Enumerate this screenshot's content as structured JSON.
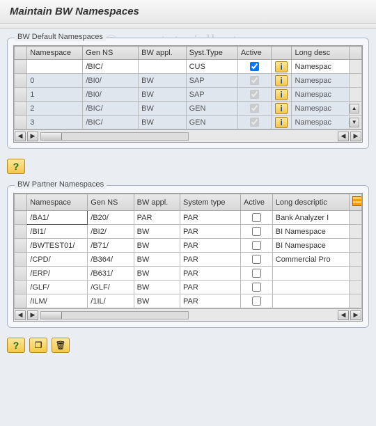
{
  "title": "Maintain BW Namespaces",
  "watermark": "© www.tutorialkart.com",
  "section1": {
    "label": "BW Default Namespaces",
    "columns": [
      "Namespace",
      "Gen NS",
      "BW appl.",
      "Syst.Type",
      "Active",
      "",
      "Long desc"
    ],
    "rows": [
      {
        "ns": "",
        "gen": "/BIC/",
        "bw": "",
        "st": "CUS",
        "active": true,
        "ro": false,
        "desc": "Namespac"
      },
      {
        "ns": "0",
        "gen": "/BI0/",
        "bw": "BW",
        "st": "SAP",
        "active": true,
        "ro": true,
        "desc": "Namespac"
      },
      {
        "ns": "1",
        "gen": "/BI0/",
        "bw": "BW",
        "st": "SAP",
        "active": true,
        "ro": true,
        "desc": "Namespac"
      },
      {
        "ns": "2",
        "gen": "/BIC/",
        "bw": "BW",
        "st": "GEN",
        "active": true,
        "ro": true,
        "desc": "Namespac"
      },
      {
        "ns": "3",
        "gen": "/BIC/",
        "bw": "BW",
        "st": "GEN",
        "active": true,
        "ro": true,
        "desc": "Namespac"
      }
    ]
  },
  "section2": {
    "label": "BW Partner Namespaces",
    "columns": [
      "Namespace",
      "Gen NS",
      "BW appl.",
      "System type",
      "Active",
      "Long descriptic"
    ],
    "rows": [
      {
        "ns": "/BA1/",
        "gen": "/B20/",
        "bw": "PAR",
        "st": "PAR",
        "active": false,
        "desc": "Bank Analyzer I",
        "sel": true
      },
      {
        "ns": "/BI1/",
        "gen": "/BI2/",
        "bw": "BW",
        "st": "PAR",
        "active": false,
        "desc": "BI Namespace "
      },
      {
        "ns": "/BWTEST01/",
        "gen": "/B71/",
        "bw": "BW",
        "st": "PAR",
        "active": false,
        "desc": "BI Namespace "
      },
      {
        "ns": "/CPD/",
        "gen": "/B364/",
        "bw": "BW",
        "st": "PAR",
        "active": false,
        "desc": "Commercial Pro"
      },
      {
        "ns": "/ERP/",
        "gen": "/B631/",
        "bw": "BW",
        "st": "PAR",
        "active": false,
        "desc": ""
      },
      {
        "ns": "/GLF/",
        "gen": "/GLF/",
        "bw": "BW",
        "st": "PAR",
        "active": false,
        "desc": ""
      },
      {
        "ns": "/ILM/",
        "gen": "/1IL/",
        "bw": "BW",
        "st": "PAR",
        "active": false,
        "desc": ""
      }
    ]
  },
  "icons": {
    "info": "i",
    "help": "?",
    "copy": "❐",
    "delete": "🗑",
    "left": "◀",
    "right": "▶",
    "up": "▲",
    "down": "▼"
  }
}
